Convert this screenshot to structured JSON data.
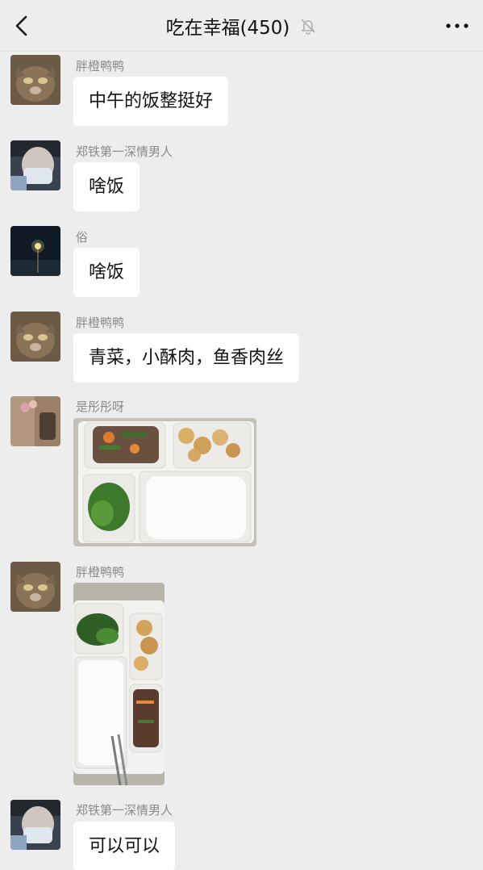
{
  "header": {
    "title": "吃在幸福(450)",
    "back_icon": "chevron-left-icon",
    "mute_icon": "bell-off-icon",
    "more_icon": "more-dots-icon"
  },
  "messages": [
    {
      "sender": "胖橙鸭鸭",
      "type": "text",
      "text": "中午的饭整挺好",
      "avatar": "cat-avatar"
    },
    {
      "sender": "郑铁第一深情男人",
      "type": "text",
      "text": "啥饭",
      "avatar": "masked-person-avatar"
    },
    {
      "sender": "俗",
      "type": "text",
      "text": "啥饭",
      "avatar": "night-lamp-avatar"
    },
    {
      "sender": "胖橙鸭鸭",
      "type": "text",
      "text": "青菜，小酥肉，鱼香肉丝",
      "avatar": "cat-avatar"
    },
    {
      "sender": "是彤彤呀",
      "type": "image",
      "image": "lunch-box-photo",
      "avatar": "flower-avatar"
    },
    {
      "sender": "胖橙鸭鸭",
      "type": "image",
      "image": "lunch-box-photo-vertical",
      "avatar": "cat-avatar"
    },
    {
      "sender": "郑铁第一深情男人",
      "type": "text",
      "text": "可以可以",
      "avatar": "masked-person-avatar"
    }
  ],
  "colors": {
    "background": "#ededed",
    "bubble": "#ffffff",
    "sender_name": "#8a8a8a",
    "text": "#111111"
  }
}
